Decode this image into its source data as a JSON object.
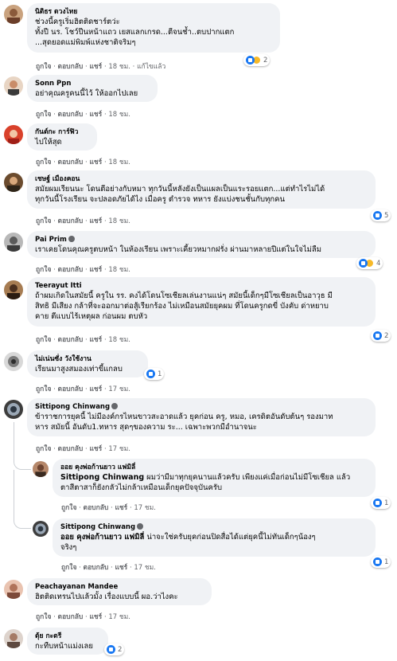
{
  "comments": [
    {
      "name": "นิติธร ดวงไทย",
      "lines": [
        "ช่วงนี้ครูเริ่มฮิตติดชาร์ตว่ะ",
        "ทั้งปี นร. โชว์ปีนหน้าแถว เยสแลกเกรด...ตีจนช้ำ..ตบปากแตก",
        "...สุดยอดแม่พิมพ์แห่งชาติจริมๆ"
      ],
      "like": "ถูกใจ",
      "reply": "ตอบกลับ",
      "share": "แชร์",
      "time": "18 ชม.",
      "edited": "แก้ไขแล้ว",
      "reactions": "2"
    },
    {
      "name": "Sonn Ppn",
      "lines": [
        "อย่าคุณครูคนนี้ไว้ ให้ออกไปเลย"
      ],
      "like": "ถูกใจ",
      "reply": "ตอบกลับ",
      "share": "แชร์",
      "time": "18 ชม."
    },
    {
      "name": "กันต์กะ การ์ฟิว",
      "lines": [
        "ไปให้สุด"
      ],
      "like": "ถูกใจ",
      "reply": "ตอบกลับ",
      "share": "แชร์",
      "time": "18 ชม."
    },
    {
      "name": "เชษฐ์ เมืองคอน",
      "lines": [
        "สมัยผมเรียนนะ โดนตีอย่างกับหมา ทุกวันนี้หลังยังเป็นแผลเป็นแระรอยแตก...แต่ทำไรไม่ได้",
        "ทุกวันนี้โรงเรียน จะปลอดภัยได้ไง เมื่อครู ตำรวจ ทหาร ยังแบ่งชนชั้นกับทุกคน"
      ],
      "like": "ถูกใจ",
      "reply": "ตอบกลับ",
      "share": "แชร์",
      "time": "18 ชม.",
      "reactions": "5"
    },
    {
      "name": "Pai Prim",
      "lines": [
        "เราเคยโดนคุณครูตบหน้า ในห้องเรียน เพราะเคี้ยวหมากฝรั่ง ผ่านมาหลายปีแต่ในใจไม่ลืม"
      ],
      "like": "ถูกใจ",
      "reply": "ตอบกลับ",
      "share": "แชร์",
      "time": "18 ชม.",
      "reactions": "4"
    },
    {
      "name": "Teerayut Itti",
      "lines": [
        "ถ้าผมเกิดในสมัยนี้ ครูใน รร. คงได้โดนโซเชียลเล่นงานแน่ๆ สมัยนี้เด็กๆมีโซเชียลเป็นอาวุธ มี",
        "สิทธิ มีเสียง กล้าที่จะออกมาต่อสู้เรียกร้อง ไม่เหมือนสมัยยุคผม ที่โดนครูกดขี่ บังคับ ด่าหยาบ",
        "คาย ตีแบบไร้เหตุผล ก่อนผม ตบหัว"
      ],
      "like": "ถูกใจ",
      "reply": "ตอบกลับ",
      "share": "แชร์",
      "time": "18 ชม.",
      "reactions": "2"
    },
    {
      "name": "ไม่เน่นซั่ง วังใช้งาน",
      "lines": [
        "เรียนมาสูงสมองเท่าขี้แกลบ"
      ],
      "like": "ถูกใจ",
      "reply": "ตอบกลับ",
      "share": "แชร์",
      "time": "17 ชม.",
      "reactions": "1"
    },
    {
      "name": "Sittipong Chinwang",
      "lines": [
        "ข้าราชการยุคนี้ ไม่มีองค์กรไหนขาวสะอาดแล้ว ยุคก่อน ครู, หมอ, เครดิตอันดับต้นๆ รองมาท",
        "หาร สมัยนี้ อันดับ1.ทหาร สุดๆของความ ระ... เฉพาะพวกมีอำนาจนะ"
      ],
      "like": "ถูกใจ",
      "reply": "ตอบกลับ",
      "share": "แชร์",
      "time": "17 ชม."
    },
    {
      "name": "ออย คุงพ่อก้านยาว แฟมิลี่",
      "mention": "Sittipong Chinwang",
      "lines": [
        "ผมว่ามีมาทุกยุคนานแล้วครับ เพียงแค่เมื่อก่อนไม่มีโซเชียล แล้ว",
        "ตาสีตาสาก็ยังกลัวไม่กล้าเหมือนเด็กยุคปัจจุบันครับ"
      ],
      "like": "ถูกใจ",
      "reply": "ตอบกลับ",
      "share": "แชร์",
      "time": "17 ชม.",
      "reactions": "1"
    },
    {
      "name": "Sittipong Chinwang",
      "mention": "ออย คุงพ่อก้านยาว แฟมิลี่",
      "lines": [
        "น่าจะใช่ครับยุคก่อนปิดสื่อได้แต่ยุคนี้ไม่ทันเด็กๆน้องๆ",
        "จริงๆ"
      ],
      "like": "ถูกใจ",
      "reply": "ตอบกลับ",
      "share": "แชร์",
      "time": "17 ชม.",
      "reactions": "1"
    },
    {
      "name": "Peachayanan Mandee",
      "lines": [
        "ฮิตติดเทรนไปแล้วมั้ง เรื่องแบบนี้ ผอ.ว่าไงคะ"
      ],
      "like": "ถูกใจ",
      "reply": "ตอบกลับ",
      "share": "แชร์",
      "time": "17 ชม."
    },
    {
      "name": "ตุ้ย กะตรี",
      "lines": [
        "กะทืบหน้าแม่งเลย"
      ],
      "reactions": "2"
    }
  ]
}
